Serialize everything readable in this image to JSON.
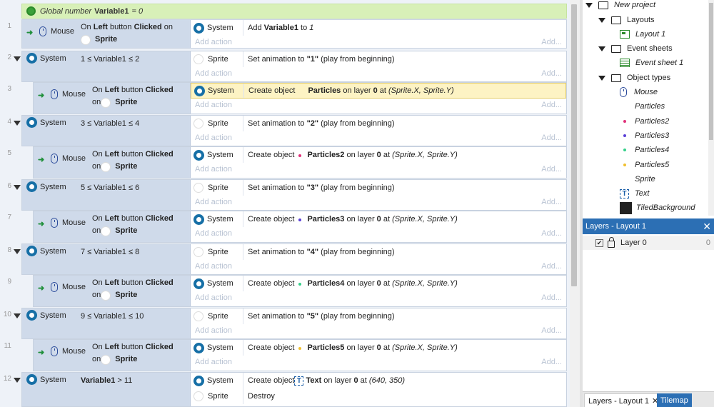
{
  "global_var": {
    "prefix": "Global number",
    "name": "Variable1",
    "suffix": "= 0"
  },
  "add_action": "Add action",
  "add_more": "Add...",
  "events": [
    {
      "num": "1",
      "kind": "trigger",
      "cond": {
        "obj": "Mouse",
        "pre": "On ",
        "b1": "Left",
        "mid": " button ",
        "b2": "Clicked",
        "post": " on",
        "obj2": "Sprite"
      },
      "actions": [
        {
          "obj": "System",
          "icon": "gear",
          "text": "Add ",
          "it": "1",
          "t2": " to ",
          "b": "Variable1"
        }
      ]
    },
    {
      "num": "2",
      "kind": "system",
      "cond": {
        "obj": "System",
        "text": "1 ≤ Variable1 ≤ 2"
      },
      "actions": [
        {
          "obj": "Sprite",
          "icon": "sprite",
          "text": "Set animation to ",
          "b": "\"1\"",
          "t2": " (play from beginning)"
        }
      ]
    },
    {
      "num": "3",
      "kind": "sub",
      "cond": {
        "obj": "Mouse",
        "pre": "On ",
        "b1": "Left",
        "mid": " button ",
        "b2": "Clicked",
        "post": "on",
        "obj2": "Sprite"
      },
      "actions": [
        {
          "obj": "System",
          "icon": "gear",
          "text": "Create object",
          "dot": "",
          "b": "Particles",
          "t2": " on layer ",
          "b2": "0",
          "t3": " at ",
          "it": "(Sprite.X, Sprite.Y)"
        }
      ]
    },
    {
      "num": "4",
      "kind": "system",
      "cond": {
        "obj": "System",
        "text": "3 ≤ Variable1 ≤ 4"
      },
      "actions": [
        {
          "obj": "Sprite",
          "icon": "sprite",
          "text": "Set animation to ",
          "b": "\"2\"",
          "t2": " (play from beginning)"
        }
      ]
    },
    {
      "num": "5",
      "kind": "sub",
      "cond": {
        "obj": "Mouse",
        "pre": "On ",
        "b1": "Left",
        "mid": " button ",
        "b2": "Clicked",
        "post": "on",
        "obj2": "Sprite"
      },
      "actions": [
        {
          "obj": "System",
          "icon": "gear",
          "text": "Create object",
          "dot": "#e0327a",
          "b": "Particles2",
          "t2": " on layer ",
          "b2": "0",
          "t3": " at ",
          "it": "(Sprite.X, Sprite.Y)"
        }
      ]
    },
    {
      "num": "6",
      "kind": "system",
      "cond": {
        "obj": "System",
        "text": "5 ≤ Variable1 ≤ 6"
      },
      "actions": [
        {
          "obj": "Sprite",
          "icon": "sprite",
          "text": "Set animation to ",
          "b": "\"3\"",
          "t2": " (play from beginning)"
        }
      ]
    },
    {
      "num": "7",
      "kind": "sub",
      "cond": {
        "obj": "Mouse",
        "pre": "On ",
        "b1": "Left",
        "mid": " button ",
        "b2": "Clicked",
        "post": "on",
        "obj2": "Sprite"
      },
      "actions": [
        {
          "obj": "System",
          "icon": "gear",
          "text": "Create object",
          "dot": "#5a3fd6",
          "b": "Particles3",
          "t2": " on layer ",
          "b2": "0",
          "t3": " at ",
          "it": "(Sprite.X, Sprite.Y)"
        }
      ]
    },
    {
      "num": "8",
      "kind": "system",
      "cond": {
        "obj": "System",
        "text": "7 ≤ Variable1 ≤ 8"
      },
      "actions": [
        {
          "obj": "Sprite",
          "icon": "sprite",
          "text": "Set animation to ",
          "b": "\"4\"",
          "t2": " (play from beginning)"
        }
      ]
    },
    {
      "num": "9",
      "kind": "sub",
      "cond": {
        "obj": "Mouse",
        "pre": "On ",
        "b1": "Left",
        "mid": " button ",
        "b2": "Clicked",
        "post": "on",
        "obj2": "Sprite"
      },
      "actions": [
        {
          "obj": "System",
          "icon": "gear",
          "text": "Create object",
          "dot": "#35d08a",
          "b": "Particles4",
          "t2": " on layer ",
          "b2": "0",
          "t3": " at ",
          "it": "(Sprite.X, Sprite.Y)"
        }
      ]
    },
    {
      "num": "10",
      "kind": "system",
      "cond": {
        "obj": "System",
        "text": "9 ≤ Variable1 ≤ 10"
      },
      "actions": [
        {
          "obj": "Sprite",
          "icon": "sprite",
          "text": "Set animation to ",
          "b": "\"5\"",
          "t2": " (play from beginning)"
        }
      ]
    },
    {
      "num": "11",
      "kind": "sub",
      "cond": {
        "obj": "Mouse",
        "pre": "On ",
        "b1": "Left",
        "mid": " button ",
        "b2": "Clicked",
        "post": "on",
        "obj2": "Sprite"
      },
      "actions": [
        {
          "obj": "System",
          "icon": "gear",
          "text": "Create object",
          "dot": "#f0c030",
          "b": "Particles5",
          "t2": " on layer ",
          "b2": "0",
          "t3": " at ",
          "it": "(Sprite.X, Sprite.Y)"
        }
      ]
    },
    {
      "num": "12",
      "kind": "system12",
      "cond": {
        "obj": "System",
        "cb": "Variable1",
        "text": " > 11"
      },
      "actions": [
        {
          "obj": "System",
          "icon": "gear",
          "text": "Create object",
          "textico": true,
          "b": "Text",
          "t2": " on layer ",
          "b2": "0",
          "t3": " at ",
          "it": "(640, 350)"
        },
        {
          "obj": "Sprite",
          "icon": "sprite",
          "text": "Destroy"
        }
      ]
    }
  ],
  "project": {
    "root": "New project",
    "layouts": "Layouts",
    "layout1": "Layout 1",
    "sheets": "Event sheets",
    "sheet1": "Event sheet 1",
    "types": "Object types",
    "objects": [
      {
        "name": "Mouse",
        "icon": "mouse"
      },
      {
        "name": "Particles",
        "icon": "none"
      },
      {
        "name": "Particles2",
        "icon": "dot",
        "color": "#e0327a"
      },
      {
        "name": "Particles3",
        "icon": "dot",
        "color": "#5a3fd6"
      },
      {
        "name": "Particles4",
        "icon": "dot",
        "color": "#35d08a"
      },
      {
        "name": "Particles5",
        "icon": "dot",
        "color": "#f0c030"
      },
      {
        "name": "Sprite",
        "icon": "none"
      },
      {
        "name": "Text",
        "icon": "text"
      },
      {
        "name": "TiledBackground",
        "icon": "tile"
      }
    ]
  },
  "layers_panel": {
    "title": "Layers - Layout 1",
    "layer": "Layer 0",
    "count": "0"
  },
  "tabs": {
    "active": "Layers - Layout 1",
    "other": "Tilemap"
  }
}
